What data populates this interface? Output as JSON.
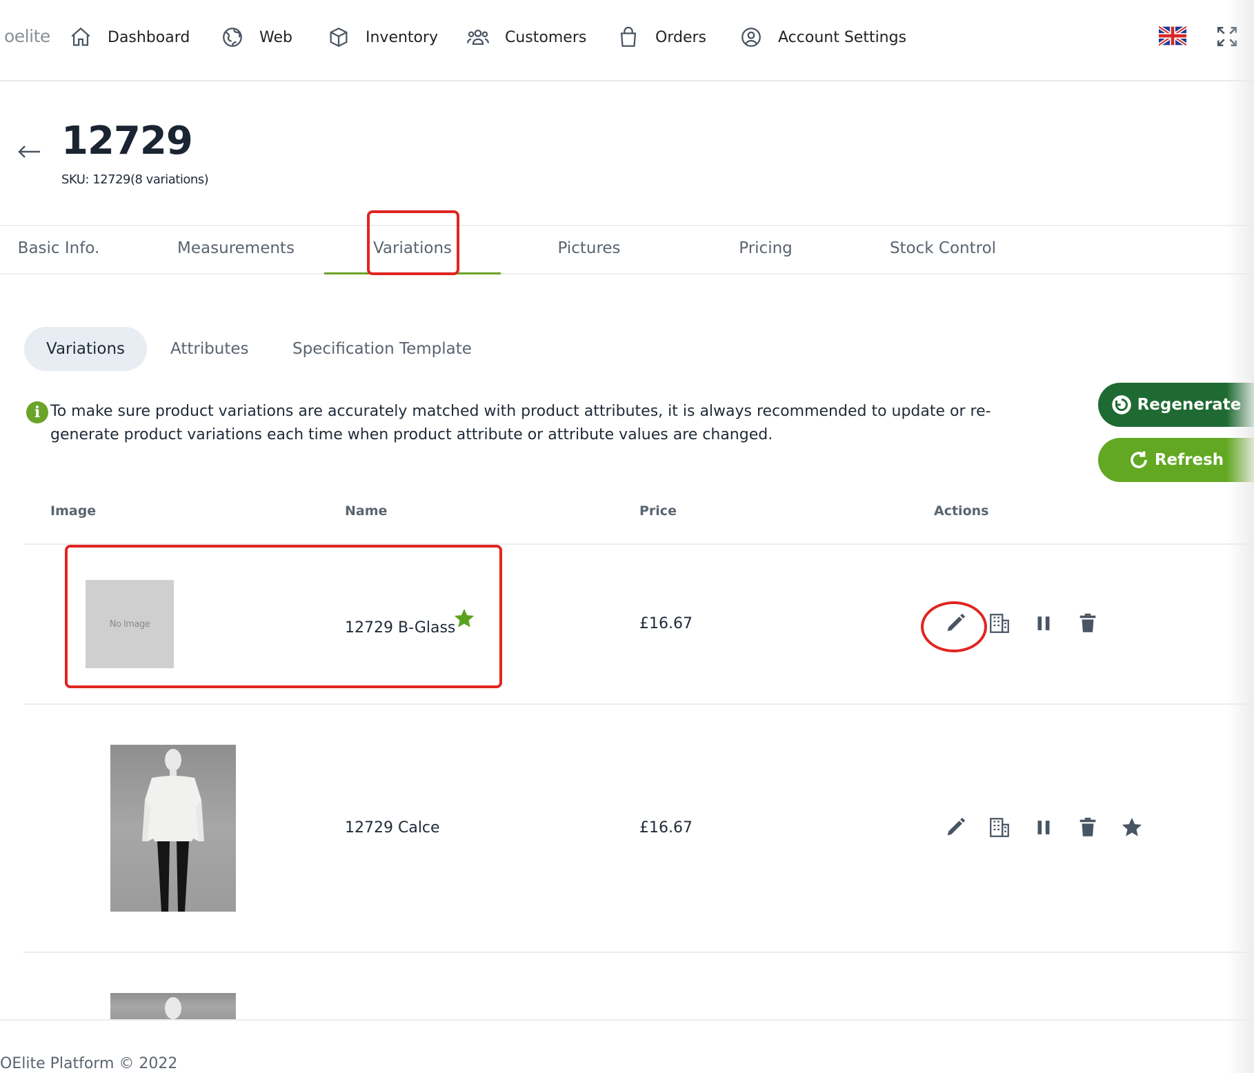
{
  "nav": {
    "logo": "oelite",
    "items": [
      {
        "label": "Dashboard",
        "icon": "home-icon"
      },
      {
        "label": "Web",
        "icon": "globe-icon"
      },
      {
        "label": "Inventory",
        "icon": "box-icon"
      },
      {
        "label": "Customers",
        "icon": "users-icon"
      },
      {
        "label": "Orders",
        "icon": "shopping-bag-icon"
      },
      {
        "label": "Account Settings",
        "icon": "user-circle-icon"
      }
    ],
    "flag_icon": "uk-flag-icon",
    "fullscreen_icon": "fullscreen-icon"
  },
  "header": {
    "title": "12729",
    "sku": "SKU: 12729(8 variations)"
  },
  "tabs": [
    {
      "label": "Basic Info."
    },
    {
      "label": "Measurements"
    },
    {
      "label": "Variations",
      "active": true
    },
    {
      "label": "Pictures"
    },
    {
      "label": "Pricing"
    },
    {
      "label": "Stock Control"
    }
  ],
  "subtabs": [
    {
      "label": "Variations",
      "active": true
    },
    {
      "label": "Attributes"
    },
    {
      "label": "Specification Template"
    }
  ],
  "info": {
    "text": "To make sure product variations are accurately matched with product attributes, it is always recommended to update or re-generate product variations each time when product attribute or attribute values are changed."
  },
  "buttons": {
    "regenerate": "Regenerate",
    "refresh": "Refresh"
  },
  "table": {
    "columns": [
      "Image",
      "Name",
      "Price",
      "Actions"
    ],
    "rows": [
      {
        "image": "No Image",
        "name": "12729 B-Glass",
        "price": "£16.67",
        "default": true
      },
      {
        "image": "photo",
        "name": "12729 Calce",
        "price": "£16.67",
        "default": false
      }
    ]
  },
  "footer": {
    "text": "OElite Platform © 2022"
  },
  "colors": {
    "accent_green": "#6aa329",
    "dark_green": "#1e6a32",
    "annotation_red": "#e02520"
  }
}
